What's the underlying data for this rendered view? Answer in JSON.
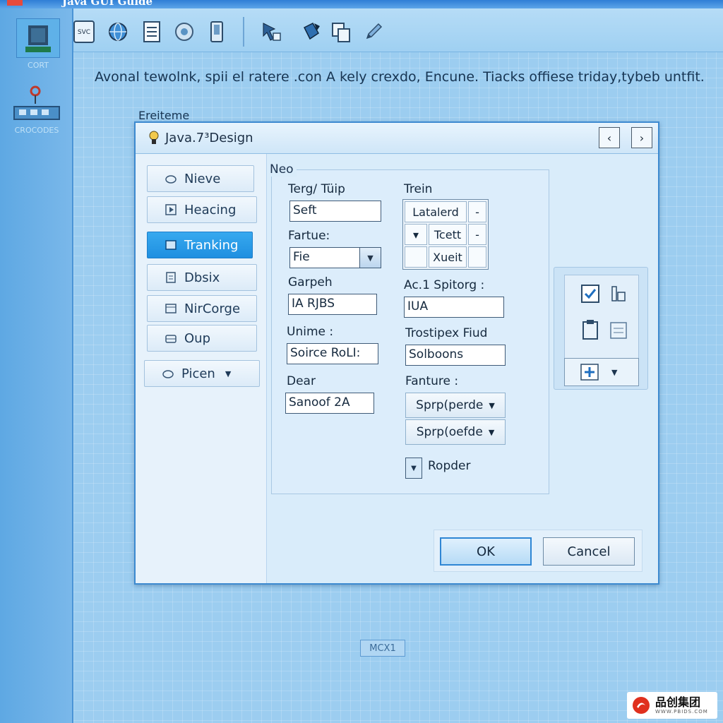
{
  "window": {
    "title": "Java GUI Guide"
  },
  "sidebar": {
    "items": [
      {
        "label": "CORT",
        "icon": "database-icon"
      },
      {
        "label": "CROCODES",
        "icon": "component-icon"
      }
    ]
  },
  "toolbar": {
    "buttons": [
      {
        "name": "svc-icon",
        "text": "SVC"
      },
      {
        "name": "globe-icon"
      },
      {
        "name": "document-icon"
      },
      {
        "name": "disc-icon"
      },
      {
        "name": "phone-icon"
      },
      {
        "name": "cursor-select-icon"
      },
      {
        "name": "paint-bucket-icon"
      },
      {
        "name": "copy-icon"
      },
      {
        "name": "pen-icon"
      }
    ]
  },
  "main": {
    "description": "Avonal tewolnk, spii el ratere .con A kely crexdo, Encune. Tiacks offiese triday,tybeb untfit.",
    "section_label": "Ereiteme",
    "mode_label": "MCX1"
  },
  "dialog": {
    "title": "Java.7³Design",
    "nav": [
      {
        "label": "Nieve",
        "icon": "cloud-icon"
      },
      {
        "label": "Heacing",
        "icon": "play-icon"
      },
      {
        "label": "Tranking",
        "icon": "panel-icon",
        "active": true
      },
      {
        "label": "Dbsix",
        "icon": "list-icon"
      },
      {
        "label": "NirCorge",
        "icon": "window-icon"
      },
      {
        "label": "Oup",
        "icon": "tray-icon"
      },
      {
        "label": "Picen",
        "icon": "cloud-icon",
        "dropdown": true
      }
    ],
    "group_label": "Neo",
    "left_fields": {
      "terg_label": "Terg/ Tüip",
      "terg_value": "Seft",
      "fartue_label": "Fartue:",
      "fartue_value": "Fie",
      "garpeh_label": "Garpeh",
      "garpeh_value": "IA RJBS",
      "unime_label": "Unime :",
      "unime_value": "Soirce RoLI:",
      "dear_label": "Dear",
      "dear_value": "Sanoof 2A"
    },
    "right_fields": {
      "trein_label": "Trein",
      "grid": {
        "r1": "Latalerd",
        "r2": "Tcett",
        "r3": "Xueit"
      },
      "spitorg_label": "Ac.1 Spitorg :",
      "spitorg_value": "IUA",
      "trostipex_label": "Trostipex Fiud",
      "trostipex_value": "Solboons",
      "fanture_label": "Fanture :",
      "dropdown1": "Sprp(perde",
      "dropdown2": "Sprp(oefde",
      "ropder_label": "Ropder"
    },
    "ok_label": "OK",
    "cancel_label": "Cancel"
  },
  "watermark": {
    "line1": "品创集团",
    "line2": "WWW.PBIDS.COM"
  },
  "colors": {
    "accent": "#1f8fe0",
    "background": "#9ccdf0",
    "dialog": "#d9ecfa"
  }
}
